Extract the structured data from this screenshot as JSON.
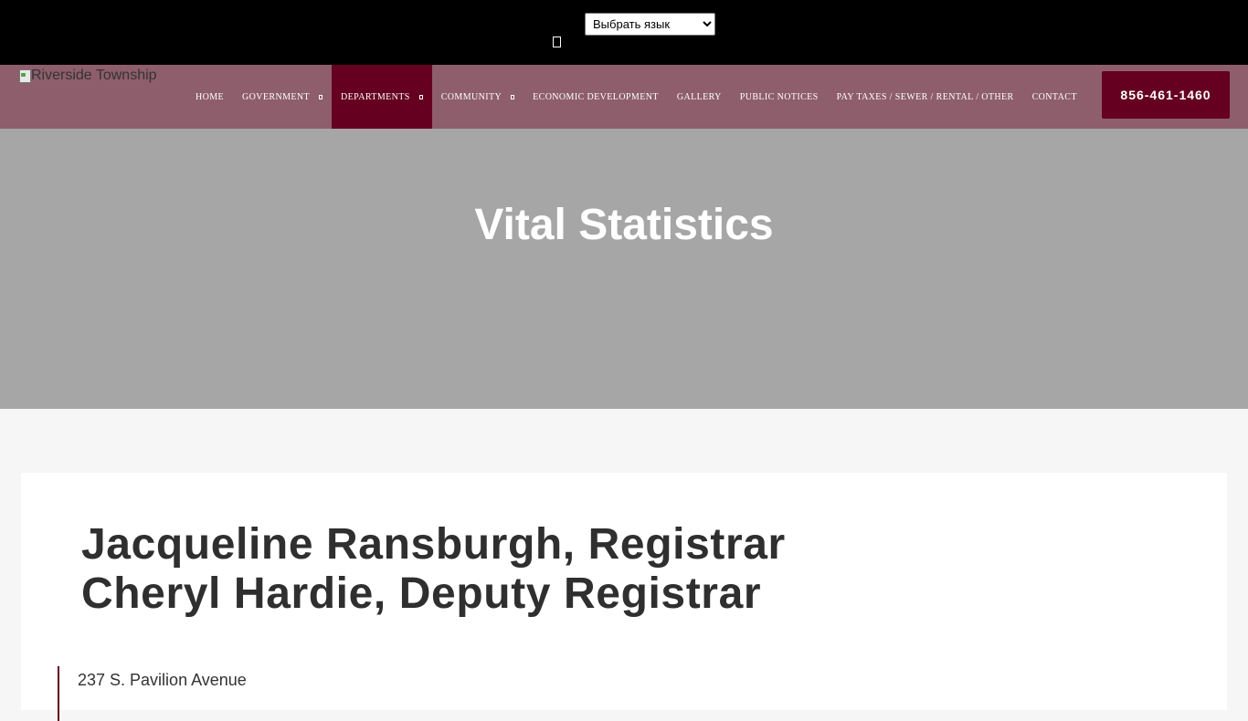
{
  "topbar": {
    "language_select": {
      "selected": "Выбрать язык",
      "options": [
        "Выбрать язык"
      ]
    }
  },
  "header": {
    "logo_alt": "Riverside Township",
    "menu": [
      {
        "label": "HOME",
        "has_submenu": false
      },
      {
        "label": "GOVERNMENT",
        "has_submenu": true
      },
      {
        "label": "DEPARTMENTS",
        "has_submenu": true,
        "active": true
      },
      {
        "label": "COMMUNITY",
        "has_submenu": true
      },
      {
        "label": "ECONOMIC DEVELOPMENT",
        "has_submenu": false
      },
      {
        "label": "GALLERY",
        "has_submenu": false
      },
      {
        "label": "PUBLIC NOTICES",
        "has_submenu": false
      },
      {
        "label": "PAY TAXES / SEWER / RENTAL / OTHER",
        "has_submenu": false
      },
      {
        "label": "CONTACT",
        "has_submenu": false
      }
    ],
    "phone": "856-461-1460"
  },
  "hero": {
    "title": "Vital Statistics"
  },
  "content": {
    "staff": [
      "Jacqueline Ransburgh, Registrar",
      "Cheryl Hardie, Deputy Registrar"
    ],
    "address_line_1": "237 S. Pavilion Avenue"
  },
  "colors": {
    "topbar_bg": "#000000",
    "nav_bg": "#8e5e6d",
    "accent": "#650020",
    "hero_bg": "#a6a6a6",
    "page_bg": "#f6f6f6"
  }
}
